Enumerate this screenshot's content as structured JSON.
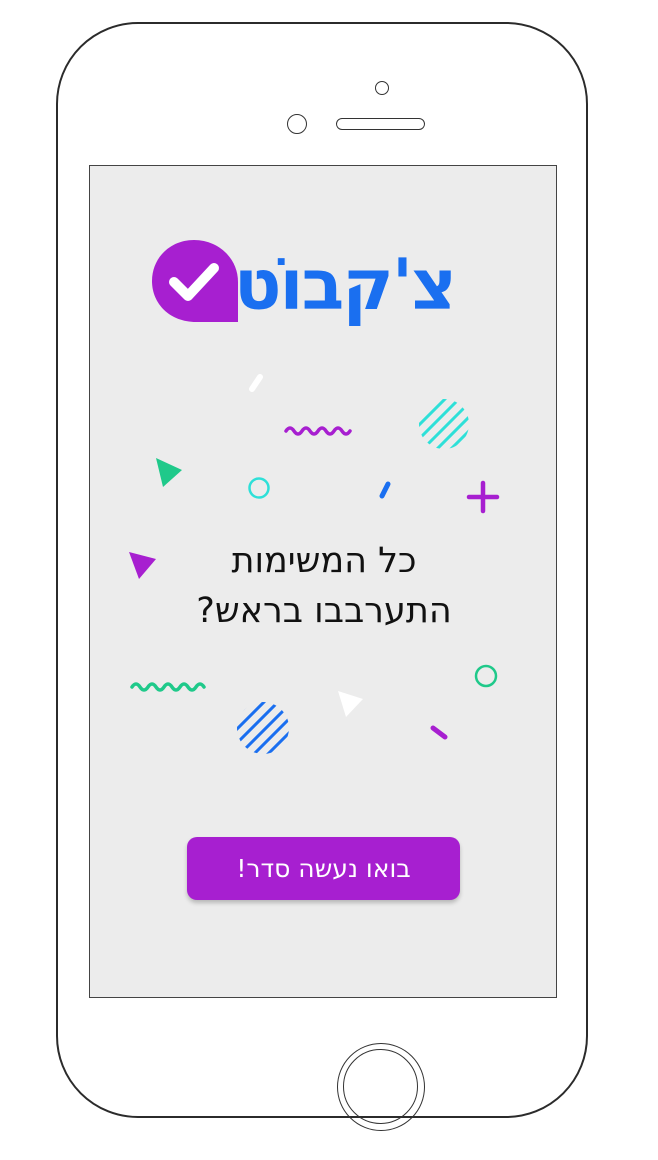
{
  "app": {
    "logo_text": "צ'קבוֹט",
    "headline_line1": "כל המשימות",
    "headline_line2": "התערבבו בראש?",
    "cta_label": "בואו נעשה סדר!"
  },
  "colors": {
    "brand_purple": "#a71fd0",
    "brand_blue": "#1a6ff0",
    "accent_green": "#1fc98a",
    "accent_cyan": "#2ee0d8",
    "screen_bg": "#ececec"
  },
  "icons": {
    "logo_badge": "check-badge-icon"
  }
}
